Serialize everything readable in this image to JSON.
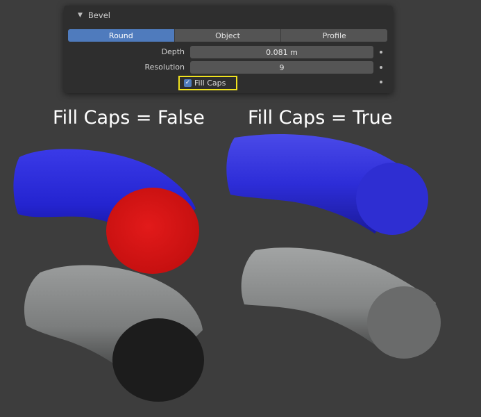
{
  "panel": {
    "title": "Bevel",
    "collapse_icon": "triangle-down-icon",
    "modes": [
      "Round",
      "Object",
      "Profile"
    ],
    "active_mode": "Round",
    "depth": {
      "label": "Depth",
      "value": "0.081 m"
    },
    "resolution": {
      "label": "Resolution",
      "value": "9"
    },
    "fill_caps": {
      "label": "Fill Caps",
      "checked": true
    }
  },
  "headings": {
    "left": "Fill Caps = False",
    "right": "Fill Caps = True"
  },
  "colors": {
    "panel_bg": "#2e2e2e",
    "accent_blue": "#4f7bbd",
    "highlight": "#f0e31f",
    "tube_blue": "#2323d6",
    "cap_red": "#d41414",
    "tube_gray": "#7d7f7f",
    "cap_black": "#1c1c1c",
    "cap_gray": "#6a6b6b"
  }
}
